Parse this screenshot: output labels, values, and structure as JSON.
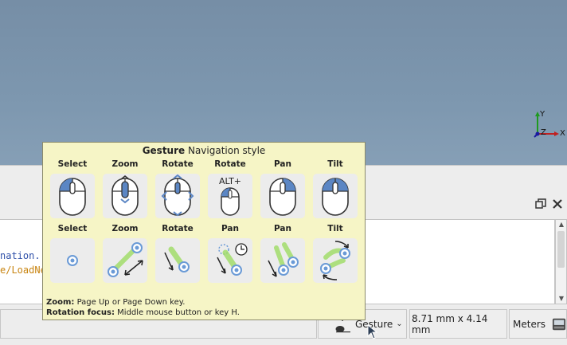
{
  "viewport": {
    "axis": {
      "x": "X",
      "y": "Y",
      "z": "Z"
    }
  },
  "panel": {
    "restore_icon": "restore-window-icon",
    "close_icon": "close-icon",
    "report_lines": [
      "nation.",
      "e/LoadNe"
    ]
  },
  "tooltip": {
    "title_bold": "Gesture",
    "title_rest": " Navigation style",
    "mouse_row": [
      {
        "label": "Select",
        "icon": "mouse-left-button-icon"
      },
      {
        "label": "Zoom",
        "icon": "mouse-wheel-scroll-icon"
      },
      {
        "label": "Rotate",
        "icon": "mouse-right-drag-icon"
      },
      {
        "label": "Rotate",
        "prefix": "ALT+",
        "icon": "mouse-left-alt-icon"
      },
      {
        "label": "Pan",
        "icon": "mouse-right-button-icon"
      },
      {
        "label": "Tilt",
        "icon": "mouse-left-right-buttons-icon"
      }
    ],
    "touch_row": [
      {
        "label": "Select",
        "icon": "tap-icon"
      },
      {
        "label": "Zoom",
        "icon": "pinch-icon"
      },
      {
        "label": "Rotate",
        "icon": "drag-icon"
      },
      {
        "label": "Pan",
        "icon": "hold-drag-icon"
      },
      {
        "label": "Pan",
        "icon": "two-finger-drag-icon"
      },
      {
        "label": "Tilt",
        "icon": "two-finger-rotate-icon"
      }
    ],
    "help": [
      {
        "key": "Zoom:",
        "text": " Page Up or Page Down key."
      },
      {
        "key": "Rotation focus:",
        "text": " Middle mouse button or key H."
      }
    ]
  },
  "statusbar": {
    "nav_style": "Gesture",
    "dimensions": "8.71 mm x 4.14 mm",
    "unit": "Meters"
  },
  "colors": {
    "tooltip_bg": "#f6f5c6",
    "mouse_button_active": "#5b86c4",
    "touch_point": "#6a9ad6",
    "gesture_trail": "#9edc63"
  }
}
